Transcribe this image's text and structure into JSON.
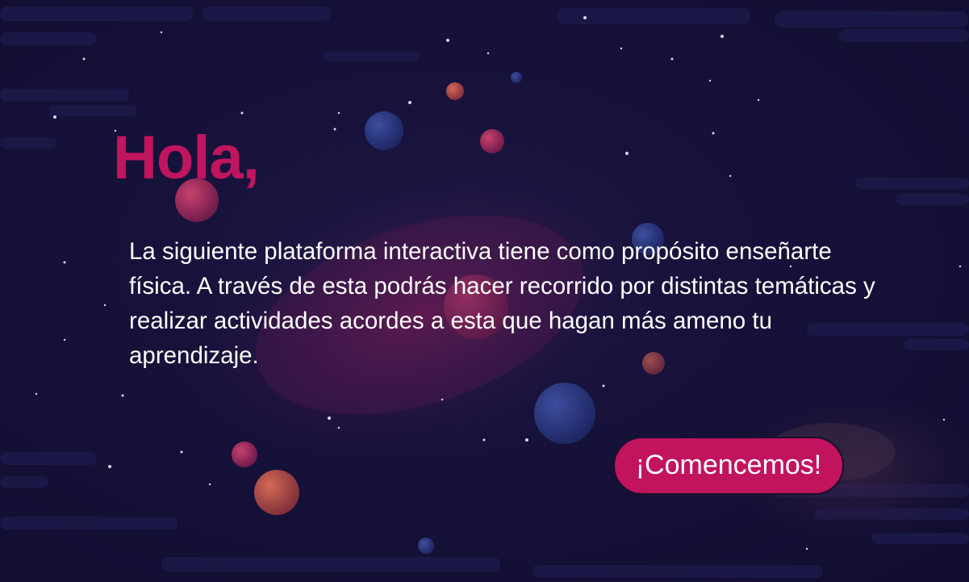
{
  "greeting": "Hola,",
  "intro": "La siguiente plataforma interactiva tiene como propósito enseñarte física. A través de esta podrás hacer recorrido por distintas temáticas y realizar actividades acordes a esta que hagan más ameno tu aprendizaje.",
  "start_button": "¡Comencemos!",
  "colors": {
    "background": "#141036",
    "accent": "#c0155f",
    "text": "#ffffff"
  }
}
